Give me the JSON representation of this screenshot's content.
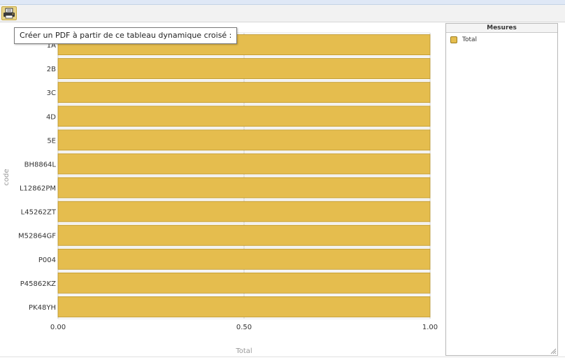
{
  "toolbar": {
    "print_icon": "printer-icon",
    "tooltip": "Créer un PDF à partir de ce tableau dynamique croisé :"
  },
  "legend": {
    "title": "Mesures",
    "items": [
      {
        "label": "Total",
        "color": "#e5bd4e"
      }
    ]
  },
  "chart_data": {
    "type": "bar",
    "orientation": "horizontal",
    "categories": [
      "1A",
      "2B",
      "3C",
      "4D",
      "5E",
      "BH8864L",
      "L12862PM",
      "L45262ZT",
      "M52864GF",
      "P004",
      "P45862KZ",
      "PK48YH"
    ],
    "series": [
      {
        "name": "Total",
        "values": [
          1,
          1,
          1,
          1,
          1,
          1,
          1,
          1,
          1,
          1,
          1,
          1
        ],
        "color": "#e5bd4e"
      }
    ],
    "xlabel": "Total",
    "ylabel": "code",
    "xlim": [
      0,
      1
    ],
    "xticks": [
      "0.00",
      "0.50",
      "1.00"
    ],
    "grid": true,
    "legend_position": "right"
  }
}
